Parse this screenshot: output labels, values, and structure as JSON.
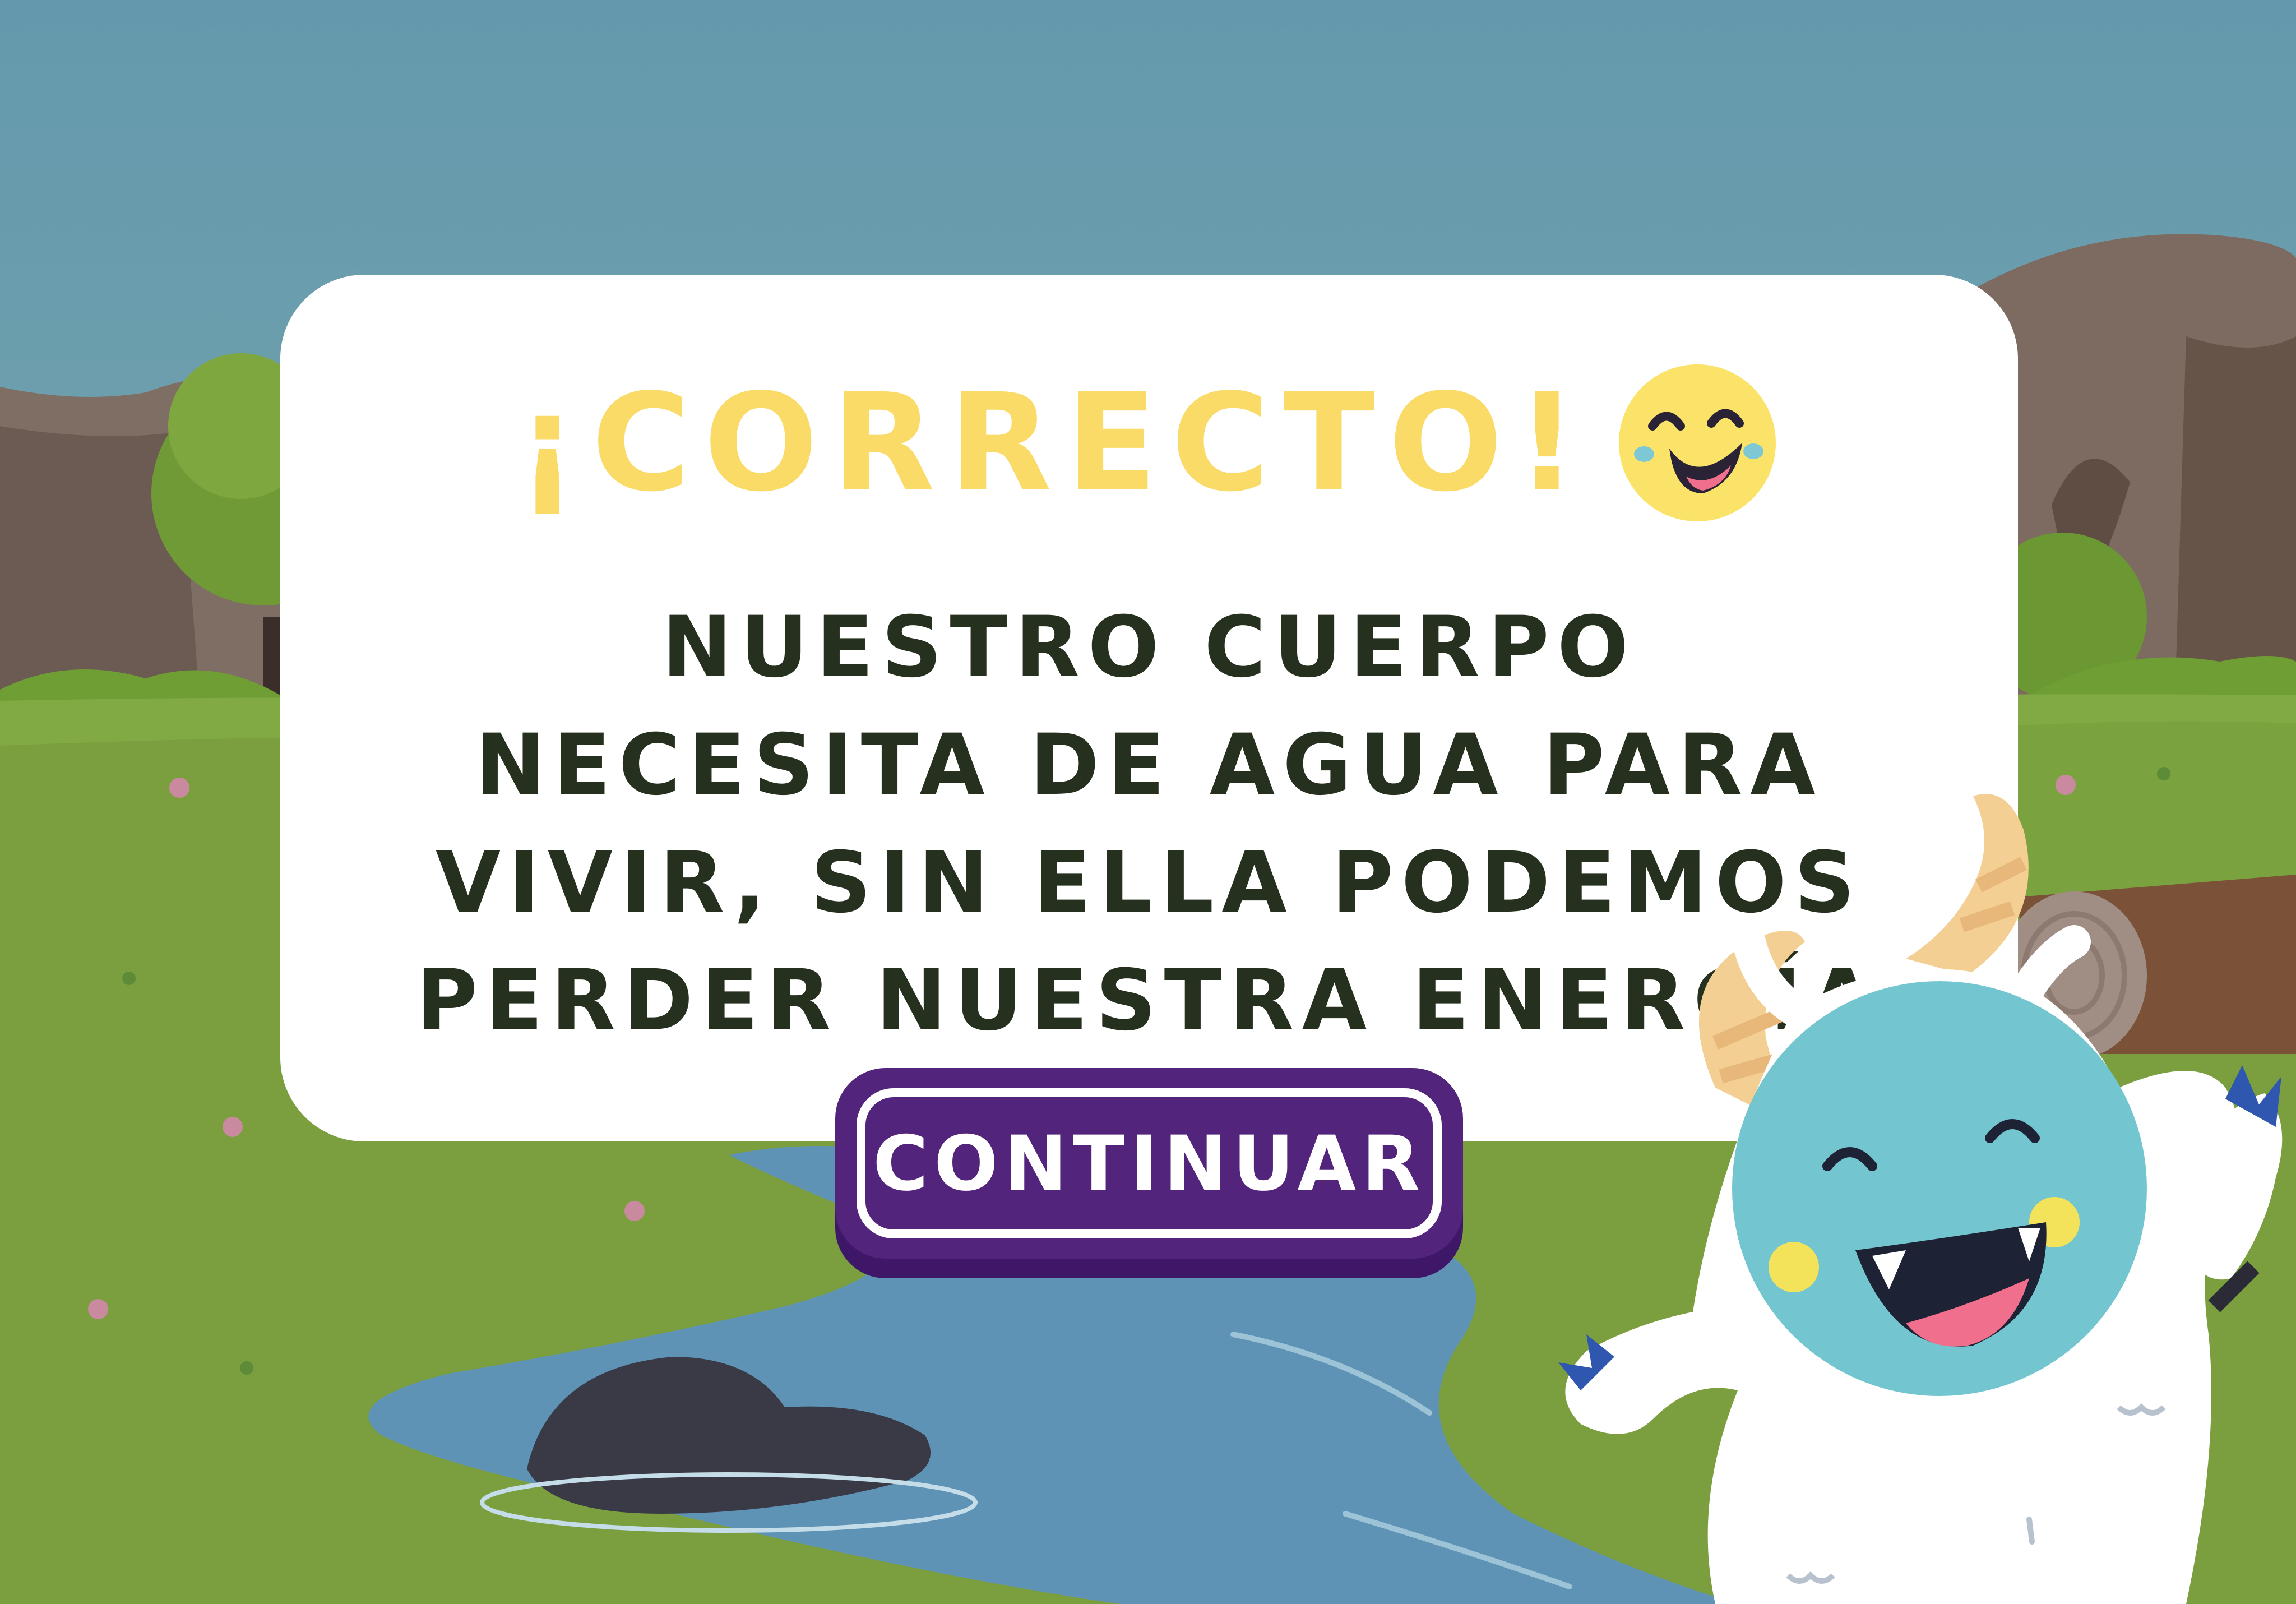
{
  "feedback": {
    "title": "¡CORRECTO!",
    "message": "NUESTRO CUERPO NECESITA DE AGUA PARA VIVIR, SIN ELLA PODEMOS PERDER NUESTRA ENERGÍA",
    "continue_label": "CONTINUAR"
  },
  "icons": {
    "feedback_emoji": "laughing-face-icon",
    "mascot": "yeti-mascot"
  },
  "colors": {
    "sky": "#6fa2b2",
    "grass": "#7a9e3e",
    "river": "#5f92b4",
    "card": "#ffffff",
    "title": "#fadb68",
    "message": "#26301f",
    "button": "#52247b",
    "button_shadow": "#3f1768",
    "mascot_face": "#72c5cf"
  }
}
